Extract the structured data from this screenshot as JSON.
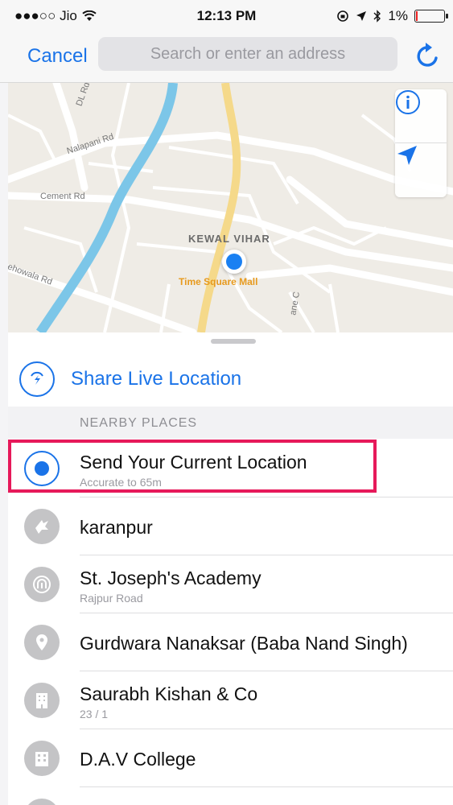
{
  "status": {
    "carrier": "●●●○○ Jio",
    "time": "12:13 PM",
    "battery": "1%"
  },
  "nav": {
    "cancel_label": "Cancel",
    "search_placeholder": "Search or enter an address"
  },
  "map": {
    "area_label": "KEWAL VIHAR",
    "poi_label": "Time Square Mall",
    "roads": [
      "DL Rd",
      "Nalapani Rd",
      "Cement Rd",
      "ehowala Rd",
      "ane C"
    ]
  },
  "share_live_label": "Share Live Location",
  "section_header": "NEARBY PLACES",
  "places": [
    {
      "title": "Send Your Current Location",
      "subtitle": "Accurate to 65m",
      "icon": "current-location-icon"
    },
    {
      "title": "karanpur",
      "subtitle": "",
      "icon": "place-icon"
    },
    {
      "title": "St. Joseph's Academy",
      "subtitle": "Rajpur Road",
      "icon": "school-icon"
    },
    {
      "title": "Gurdwara Nanaksar (Baba Nand Singh)",
      "subtitle": "",
      "icon": "pin-icon"
    },
    {
      "title": "Saurabh Kishan & Co",
      "subtitle": "23 / 1",
      "icon": "building-icon"
    },
    {
      "title": "D.A.V College",
      "subtitle": "",
      "icon": "college-icon"
    }
  ],
  "colors": {
    "accent": "#1a73e8",
    "highlight": "#e6195a",
    "river": "#7cc6e8",
    "main_road": "#f5d98a"
  }
}
